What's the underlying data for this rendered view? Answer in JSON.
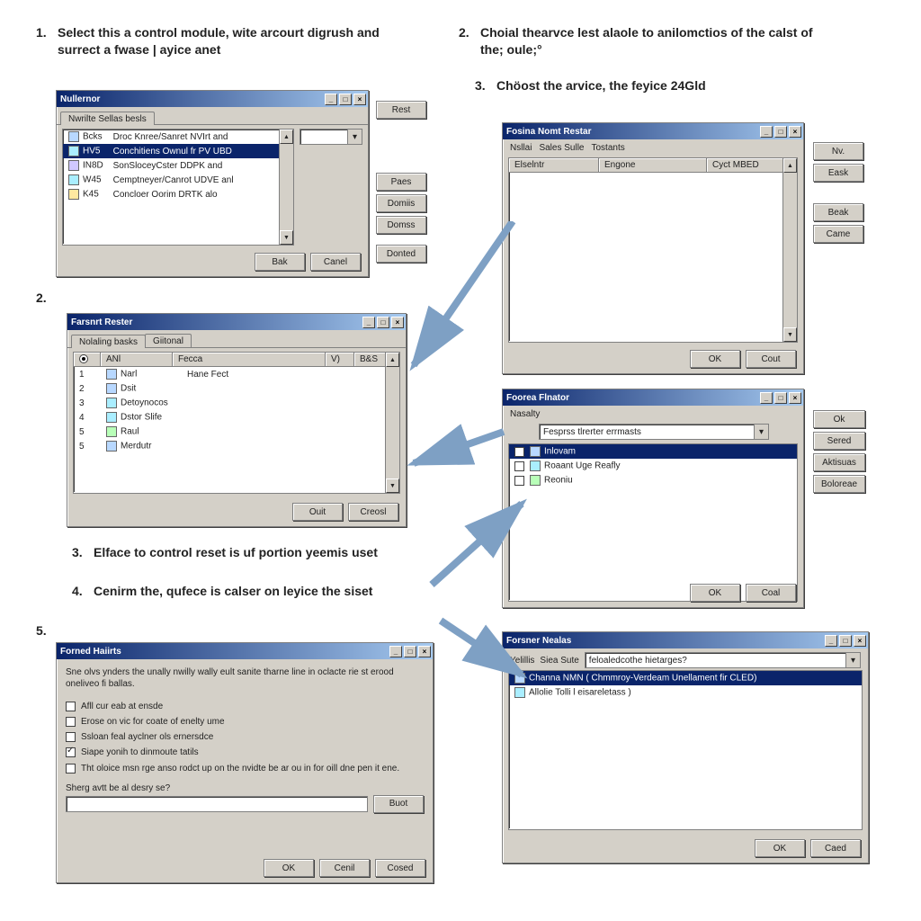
{
  "steps": {
    "s1": {
      "num": "1.",
      "text": "Select this a control module, wite arcourt digrush and surrect a fwase | ayice anet"
    },
    "s2a": {
      "num": "2.",
      "text": ""
    },
    "s2b": {
      "num": "2.",
      "text": "Choial thearvce lest alaole to anilomctios of the calst of the; oule;°"
    },
    "s3b": {
      "num": "3.",
      "text": "Chöost the arvice, the feyice 24Gld"
    },
    "s3": {
      "num": "3.",
      "text": "Elface to control reset is uf portion yeemis uset"
    },
    "s4": {
      "num": "4.",
      "text": "Cenirm the, qufece is calser on leyice the siset"
    },
    "s5": {
      "num": "5.",
      "text": ""
    }
  },
  "winA": {
    "title": "Nullernor",
    "tab_label": "Nwrilte Sellas besls",
    "buttons": {
      "reset": "Rest",
      "paes": "Paes",
      "domis": "Domiis",
      "domis2": "Domss",
      "donted": "Donted",
      "back": "Bak",
      "cancel": "Canel"
    },
    "header": {
      "c1": "",
      "c2": ""
    },
    "columns_w": [
      60,
      260
    ],
    "rows": [
      {
        "icon": "i-blue",
        "c1": "Bcks",
        "c2": "Droc Knree/Sanret NVIrt and",
        "sel": false
      },
      {
        "icon": "i-cyan",
        "c1": "HV5",
        "c2": "Conchitiens Ownul fr PV UBD",
        "sel": true
      },
      {
        "icon": "i-lav",
        "c1": "IN8D",
        "c2": "SonSloceyCster DDPK and",
        "sel": false
      },
      {
        "icon": "i-cyan",
        "c1": "W45",
        "c2": "Cemptneyer/Canrot UDVE anl",
        "sel": false
      },
      {
        "icon": "i-yel",
        "c1": "K45",
        "c2": "Concloer Oorim DRTK alo",
        "sel": false
      }
    ]
  },
  "winB": {
    "title": "Farsnrt Rester",
    "tab1": "Nolaling basks",
    "tab2": "Giitonal",
    "buttons": {
      "out": "Ouit",
      "cancel": "Creosl"
    },
    "head": {
      "c1": "ANl",
      "c2": "Fecca",
      "c3": "V)",
      "c4": "B&S"
    },
    "columns_w": [
      30,
      90,
      160,
      30,
      26
    ],
    "rows": [
      {
        "n": "1",
        "ic": "i-blue",
        "c1": "Narl",
        "c2": "Hane Fect"
      },
      {
        "n": "2",
        "ic": "i-blue",
        "c1": "Dsit",
        "c2": ""
      },
      {
        "n": "3",
        "ic": "i-cyan",
        "c1": "Detoynocos",
        "c2": ""
      },
      {
        "n": "4",
        "ic": "i-cyan",
        "c1": "Dstor Slife",
        "c2": ""
      },
      {
        "n": "5",
        "ic": "i-grn",
        "c1": "Raul",
        "c2": ""
      },
      {
        "n": "5",
        "ic": "i-blue",
        "c1": "Merdutr",
        "c2": ""
      }
    ]
  },
  "winC": {
    "title": "Fosina Nomt Restar",
    "tab_l": "Nsllai",
    "tab_m": "Sales Sulle",
    "tab_r": "Tostants",
    "header": {
      "c1": "Elselntr",
      "c2": "Engone",
      "c3": "Cyct MBED"
    },
    "buttons": {
      "nx": "Nv.",
      "eak": "Eask",
      "bak": "Beak",
      "came": "Came",
      "ok": "OK",
      "cancel": "Cout"
    }
  },
  "winD": {
    "title": "Foorea Flnator",
    "tab_l": "Nasalty",
    "drop_label": "Fesprss tlrerter errmasts",
    "rows": [
      {
        "ic": "i-blue",
        "label": "Inlovam",
        "sel": true
      },
      {
        "ic": "i-cyan",
        "label": "Roaant Uge Reafly",
        "sel": false
      },
      {
        "ic": "i-grn",
        "label": "Reoniu",
        "sel": false
      }
    ],
    "buttons": {
      "ok": "Ok",
      "sered": "Sered",
      "ahtas": "Aktisuas",
      "botored": "Boloreae",
      "ok2": "OK",
      "cancel": "Coal"
    }
  },
  "winE": {
    "title": "Forned Haiirts",
    "desc": "Sne olvs ynders the unally nwilly wally eult sanite tharne line in oclacte rie st erood oneliveo fi ballas.",
    "checks": [
      {
        "label": "Afll cur eab at ensde",
        "on": false
      },
      {
        "label": "Erose on vic for coate of enelty ume",
        "on": false
      },
      {
        "label": "Ssloan feal ayclner ols ernersdce",
        "on": false
      },
      {
        "label": "Siape yonih to dinmoute tatils",
        "on": true
      },
      {
        "label": "Tht oloice msn rge anso rodct up on the nvidte be ar ou in for oill dne pen it ene.",
        "on": false
      }
    ],
    "prompt": "Sherg avtt be al desry se?",
    "buttons": {
      "set": "Buot",
      "ok": "OK",
      "cancel": "Cenil",
      "close": "Cosed"
    }
  },
  "winF": {
    "title": "Forsner Nealas",
    "tab_l": "Yelillis",
    "tab_m": "Siea Sute",
    "drop_label": "feloaledcothe hietarges?",
    "rows": [
      {
        "ic": "i-blue",
        "label": "Channa NMN ( Chmmroy-Verdeam Unellament fir CLED)",
        "sel": true
      },
      {
        "ic": "i-cyan",
        "label": "Allolie Tolli l eisareletass )",
        "sel": false
      }
    ],
    "buttons": {
      "ok": "OK",
      "cancel": "Caed"
    }
  }
}
